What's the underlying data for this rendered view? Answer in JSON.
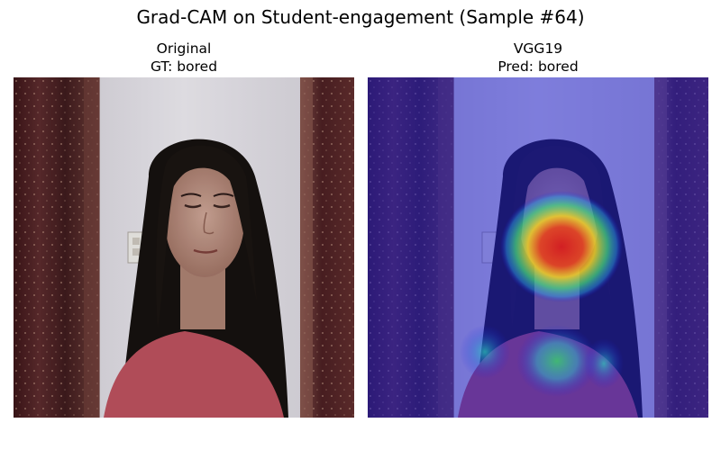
{
  "figure": {
    "title": "Grad-CAM on Student-engagement (Sample #64)"
  },
  "panels": [
    {
      "model_label": "Original",
      "label_line": "GT: bored",
      "image_description": "webcam photo of a student looking down"
    },
    {
      "model_label": "VGG19",
      "label_line": "Pred: bored",
      "image_description": "same photo with Grad-CAM heatmap overlay"
    }
  ],
  "colors": {
    "curtain": "#4a1f22",
    "wall": "#dcd9e0",
    "hair": "#15110f",
    "skin": "#b98f7f",
    "shirt": "#b8505c",
    "heatmap_low": "#1a1ae6",
    "heatmap_high": "#d81c1c"
  }
}
